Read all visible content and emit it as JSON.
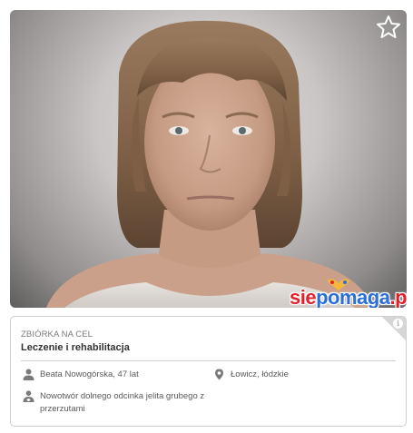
{
  "photo": {
    "alt": "Portrait of fundraiser beneficiary"
  },
  "favorite": {
    "icon": "star-outline-icon"
  },
  "logo": {
    "part1": "sie",
    "part2": "pomaga",
    "part3": ".pl"
  },
  "info": {
    "kicker": "ZBIÓRKA NA CEL",
    "title": "Leczenie i rehabilitacja",
    "person": "Beata Nowogórska, 47 lat",
    "location": "Łowicz, łódzkie",
    "diagnosis": "Nowotwór dolnego odcinka jelita grubego z przerzutami",
    "info_badge": "i"
  },
  "colors": {
    "logo_red": "#e2202b",
    "logo_blue": "#2a6fd6",
    "icon_gray": "#7a7a7a"
  }
}
